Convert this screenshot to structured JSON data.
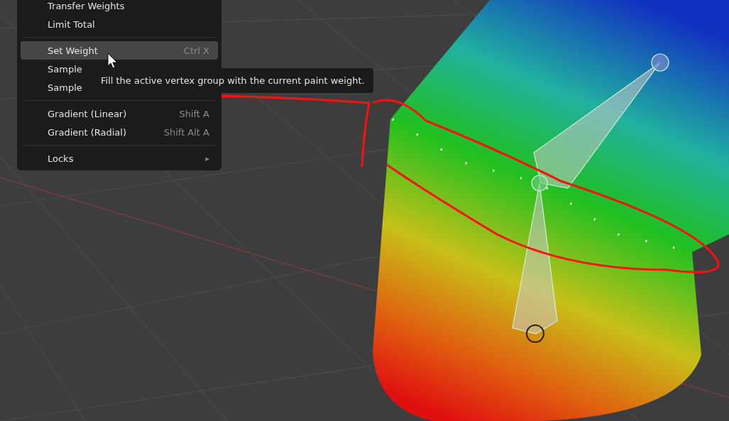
{
  "menu": {
    "items": [
      {
        "kind": "item",
        "label": "Transfer Weights",
        "selected": false
      },
      {
        "kind": "item",
        "label": "Limit Total",
        "selected": false
      },
      {
        "kind": "separator"
      },
      {
        "kind": "item",
        "label": "Set Weight",
        "shortcut": "Ctrl X",
        "selected": true
      },
      {
        "kind": "item",
        "label": "Sample",
        "selected": false
      },
      {
        "kind": "item",
        "label": "Sample",
        "selected": false
      },
      {
        "kind": "separator"
      },
      {
        "kind": "item",
        "label": "Gradient (Linear)",
        "shortcut": "Shift A",
        "selected": false
      },
      {
        "kind": "item",
        "label": "Gradient (Radial)",
        "shortcut": "Shift Alt A",
        "selected": false
      },
      {
        "kind": "separator"
      },
      {
        "kind": "submenu",
        "label": "Locks",
        "arrow": "▸",
        "selected": false
      }
    ]
  },
  "tooltip": {
    "text": "Fill the active vertex group with the current paint weight."
  }
}
